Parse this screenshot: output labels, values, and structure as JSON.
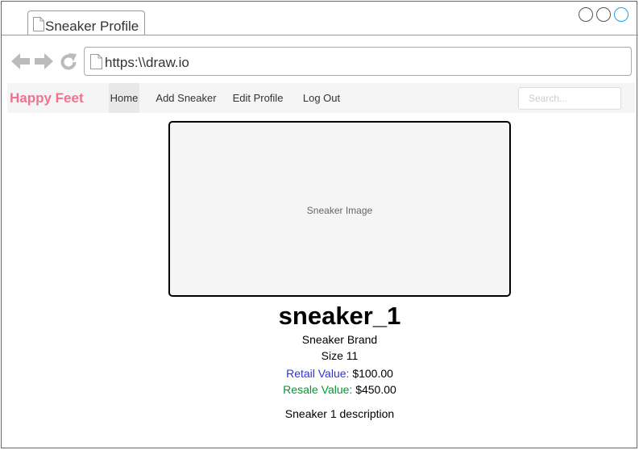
{
  "browser": {
    "tab_title": "Sneaker Profile",
    "url": "https:\\\\draw.io",
    "icons": [
      "back-arrow-icon",
      "forward-arrow-icon",
      "reload-icon",
      "document-icon"
    ]
  },
  "navbar": {
    "brand": "Happy Feet",
    "brand_color": "#f0728f",
    "items": [
      {
        "label": "Home",
        "active": true
      },
      {
        "label": "Add Sneaker",
        "active": false
      },
      {
        "label": "Edit Profile",
        "active": false
      },
      {
        "label": "Log Out",
        "active": false
      }
    ],
    "search_placeholder": "Search..."
  },
  "sneaker": {
    "image_label": "Sneaker Image",
    "name": "sneaker_1",
    "brand": "Sneaker Brand",
    "size": "Size 11",
    "retail_label": "Retail Value:",
    "retail_value": "$100.00",
    "retail_label_color": "#3333cc",
    "resale_label": "Resale Value:",
    "resale_value": "$450.00",
    "resale_label_color": "#009933",
    "description": "Sneaker 1 description"
  }
}
